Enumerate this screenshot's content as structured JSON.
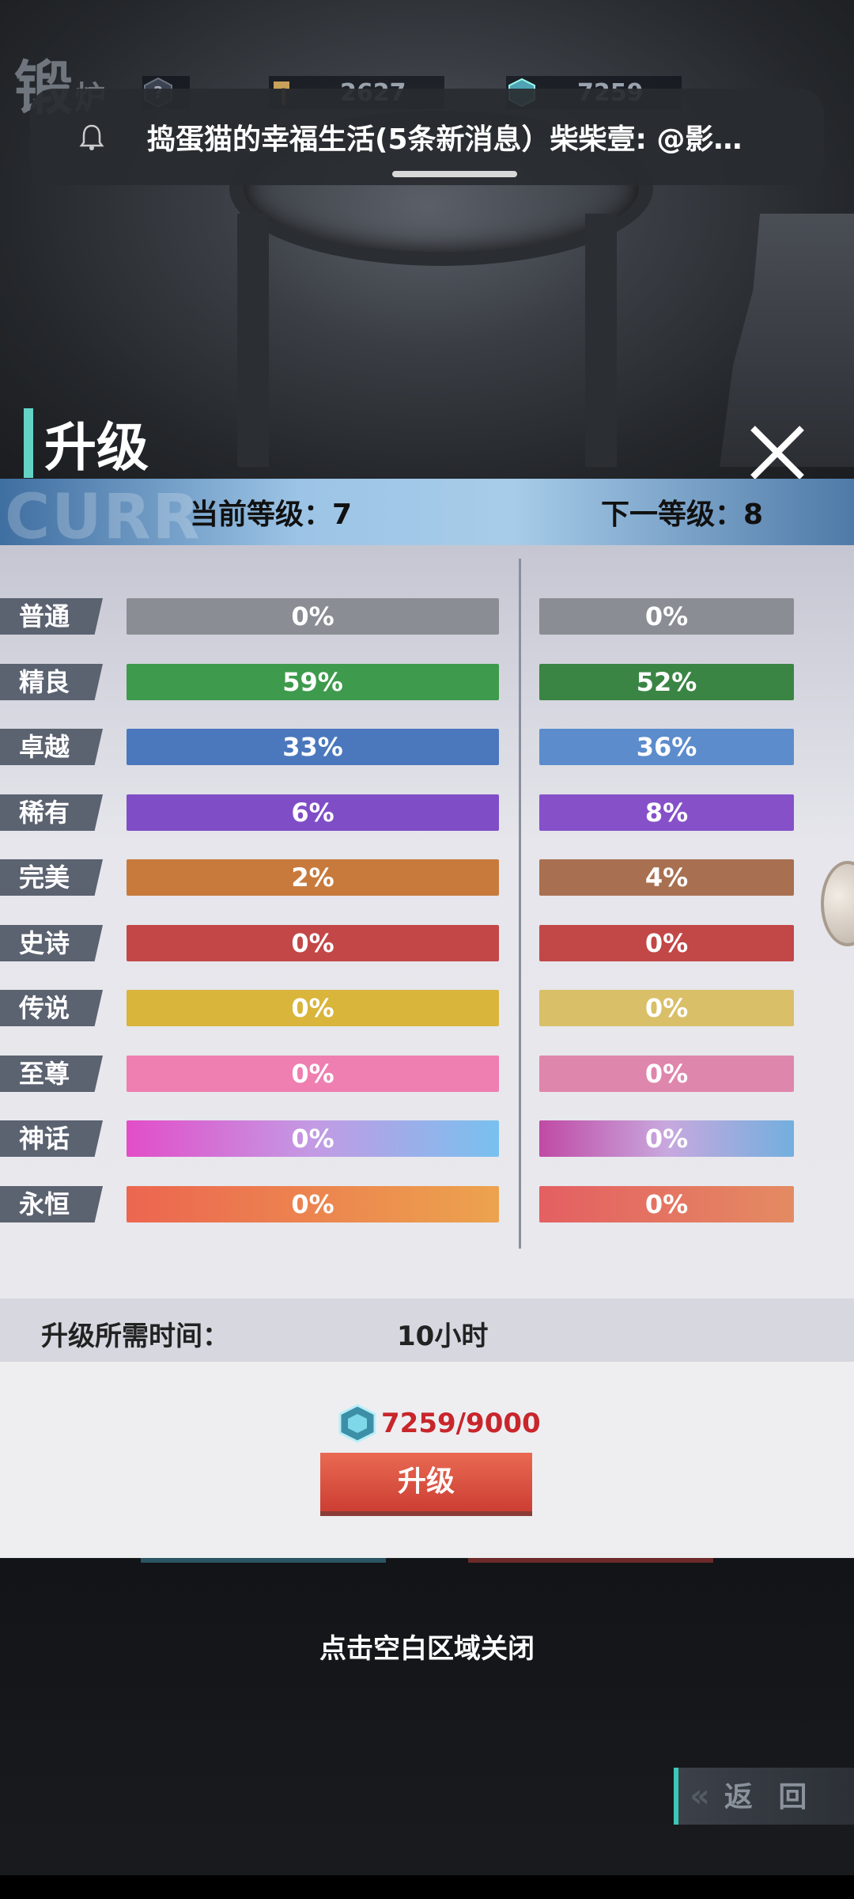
{
  "hud": {
    "title_main": "锻",
    "title_small": "炉",
    "resource1_value": "2627",
    "resource2_value": "7259"
  },
  "notification": {
    "text": "捣蛋猫的幸福生活(5条新消息）柴柴壹: @影…"
  },
  "dialog": {
    "title": "升级",
    "ghost_text": "CURR",
    "current_level_label": "当前等级：7",
    "next_level_label": "下一等级：8",
    "rows": [
      {
        "name": "普通",
        "current": "0%",
        "next": "0%",
        "color_cur": "#8a8d93",
        "color_next": "#8a8d93"
      },
      {
        "name": "精良",
        "current": "59%",
        "next": "52%",
        "color_cur": "#3e9a4c",
        "color_next": "#3a8544"
      },
      {
        "name": "卓越",
        "current": "33%",
        "next": "36%",
        "color_cur": "#4b77bd",
        "color_next": "#5c8ccc"
      },
      {
        "name": "稀有",
        "current": "6%",
        "next": "8%",
        "color_cur": "#7f4ec7",
        "color_next": "#8650c9"
      },
      {
        "name": "完美",
        "current": "2%",
        "next": "4%",
        "color_cur": "#c87a3d",
        "color_next": "#a87050"
      },
      {
        "name": "史诗",
        "current": "0%",
        "next": "0%",
        "color_cur": "#c44747",
        "color_next": "#c24747"
      },
      {
        "name": "传说",
        "current": "0%",
        "next": "0%",
        "color_cur": "#d9b53b",
        "color_next": "#d9bf68"
      },
      {
        "name": "至尊",
        "current": "0%",
        "next": "0%",
        "color_cur": "#ef7fb1",
        "color_next": "#df86ad"
      },
      {
        "name": "神话",
        "current": "0%",
        "next": "0%",
        "gradient_cur": "linear-gradient(90deg,#e24dc8,#c39ae4 50%,#78c1ef)",
        "gradient_next": "linear-gradient(90deg,#c04aa5,#c8a8de 50%,#72afde)"
      },
      {
        "name": "永恒",
        "current": "0%",
        "next": "0%",
        "gradient_cur": "linear-gradient(90deg,#ec6650,#eca34e)",
        "gradient_next": "linear-gradient(90deg,#e45f62,#e48b62)"
      }
    ],
    "time_label": "升级所需时间：",
    "time_value": "10小时",
    "cost_text": "7259/9000",
    "upgrade_button": "升级"
  },
  "hint": "点击空白区域关闭",
  "back_button": "返 回",
  "colors": {
    "accent": "#63d3c6",
    "cost_red": "#c8262b"
  }
}
